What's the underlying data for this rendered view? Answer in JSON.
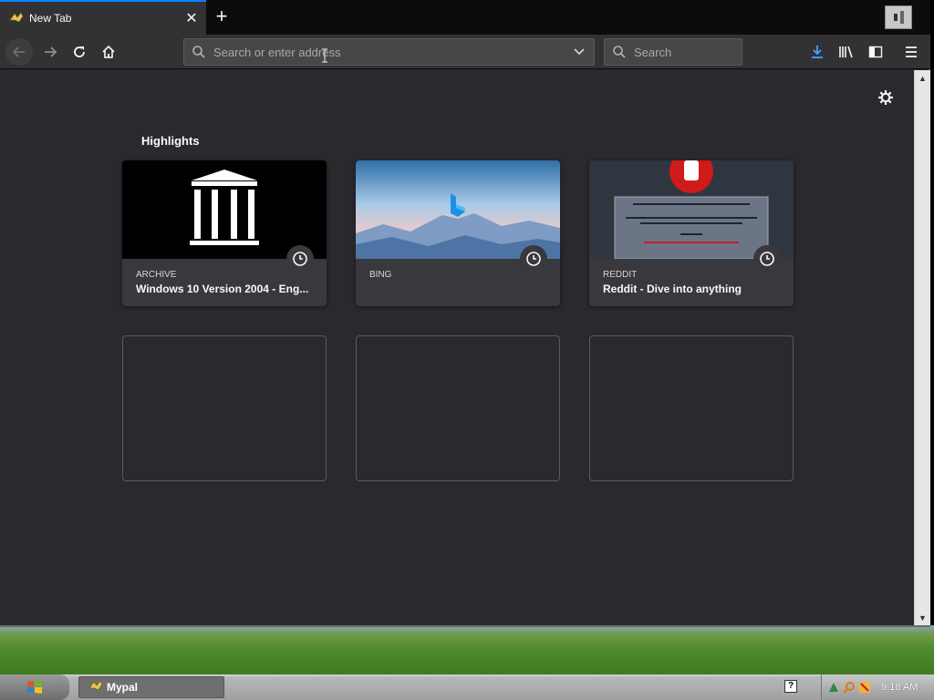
{
  "tabs": [
    {
      "title": "New Tab",
      "favicon": "mypal-icon",
      "active": true
    }
  ],
  "toolbar": {
    "url_placeholder": "Search or enter address",
    "search_placeholder": "Search"
  },
  "content": {
    "section_title": "Highlights",
    "highlights": [
      {
        "domain": "ARCHIVE",
        "title": "Windows 10 Version 2004 - Eng...",
        "thumb": "archive-logo"
      },
      {
        "domain": "BING",
        "title": "",
        "thumb": "bing-mountains"
      },
      {
        "domain": "REDDIT",
        "title": "Reddit - Dive into anything",
        "thumb": "reddit-block-page"
      }
    ]
  },
  "taskbar": {
    "task_label": "Mypal",
    "help_label": "?",
    "clock": "9:18 AM"
  },
  "colors": {
    "accent": "#0a84ff",
    "toolbar_bg": "#323234",
    "content_bg": "#2a2a2e",
    "card_bg": "#38383d"
  }
}
